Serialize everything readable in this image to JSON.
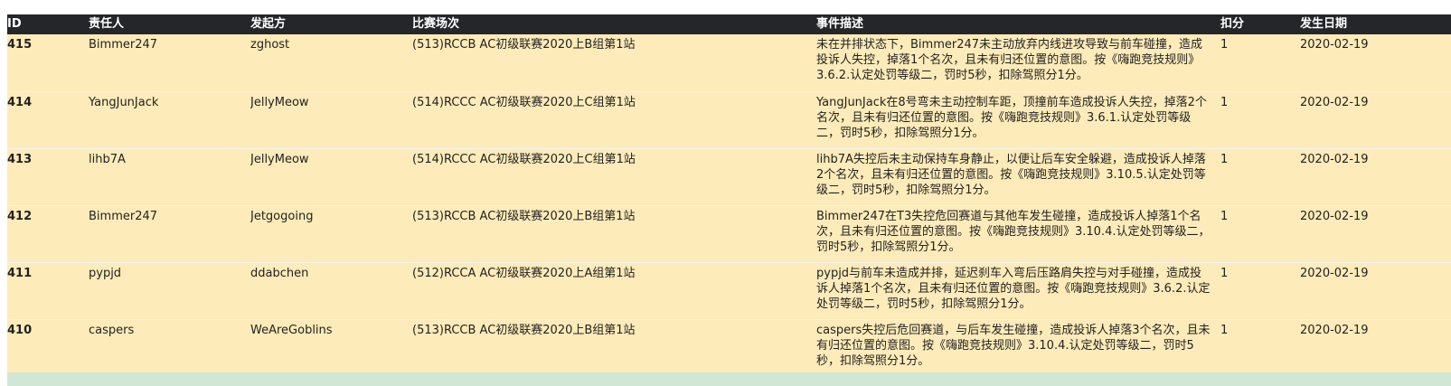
{
  "table": {
    "headers": {
      "id": "ID",
      "person": "责任人",
      "initiator": "发起方",
      "race": "比赛场次",
      "description": "事件描述",
      "penalty": "扣分",
      "date": "发生日期"
    },
    "rows": [
      {
        "id": "415",
        "person": "Bimmer247",
        "initiator": "zghost",
        "race": "(513)RCCB AC初级联赛2020上B组第1站",
        "description": "未在并排状态下，Bimmer247未主动放弃内线进攻导致与前车碰撞，造成投诉人失控，掉落1个名次，且未有归还位置的意图。按《嗨跑竞技规则》3.6.2.认定处罚等级二，罚时5秒，扣除驾照分1分。",
        "penalty": "1",
        "date": "2020-02-19"
      },
      {
        "id": "414",
        "person": "YangJunJack",
        "initiator": "JellyMeow",
        "race": "(514)RCCC AC初级联赛2020上C组第1站",
        "description": "YangJunJack在8号弯未主动控制车距，顶撞前车造成投诉人失控，掉落2个名次，且未有归还位置的意图。按《嗨跑竞技规则》3.6.1.认定处罚等级二，罚时5秒，扣除驾照分1分。",
        "penalty": "1",
        "date": "2020-02-19"
      },
      {
        "id": "413",
        "person": "lihb7A",
        "initiator": "JellyMeow",
        "race": "(514)RCCC AC初级联赛2020上C组第1站",
        "description": "lihb7A失控后未主动保持车身静止，以便让后车安全躲避，造成投诉人掉落2个名次，且未有归还位置的意图。按《嗨跑竞技规则》3.10.5.认定处罚等级二，罚时5秒，扣除驾照分1分。",
        "penalty": "1",
        "date": "2020-02-19"
      },
      {
        "id": "412",
        "person": "Bimmer247",
        "initiator": "Jetgogoing",
        "race": "(513)RCCB AC初级联赛2020上B组第1站",
        "description": "Bimmer247在T3失控危回赛道与其他车发生碰撞，造成投诉人掉落1个名次，且未有归还位置的意图。按《嗨跑竞技规则》3.10.4.认定处罚等级二，罚时5秒，扣除驾照分1分。",
        "penalty": "1",
        "date": "2020-02-19"
      },
      {
        "id": "411",
        "person": "pypjd",
        "initiator": "ddabchen",
        "race": "(512)RCCA AC初级联赛2020上A组第1站",
        "description": "pypjd与前车未造成并排，延迟刹车入弯后压路肩失控与对手碰撞，造成投诉人掉落1个名次，且未有归还位置的意图。按《嗨跑竞技规则》3.6.2.认定处罚等级二，罚时5秒，扣除驾照分1分。",
        "penalty": "1",
        "date": "2020-02-19"
      },
      {
        "id": "410",
        "person": "caspers",
        "initiator": "WeAreGoblins",
        "race": "(513)RCCB AC初级联赛2020上B组第1站",
        "description": "caspers失控后危回赛道，与后车发生碰撞，造成投诉人掉落3个名次，且未有归还位置的意图。按《嗨跑竞技规则》3.10.4.认定处罚等级二，罚时5秒，扣除驾照分1分。",
        "penalty": "1",
        "date": "2020-02-19"
      }
    ]
  }
}
